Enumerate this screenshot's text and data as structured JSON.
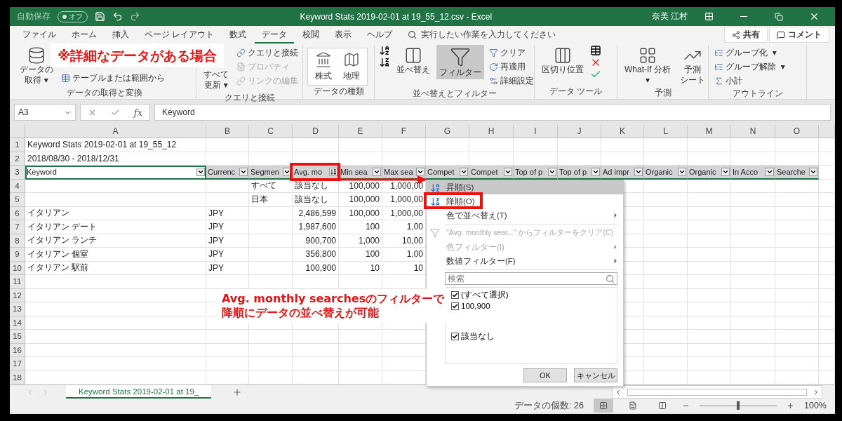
{
  "title_bar": {
    "autosave_label": "自動保存",
    "autosave_state": "オフ",
    "title": "Keyword Stats 2019-02-01 at 19_55_12.csv  -  Excel",
    "user": "奈美 江村"
  },
  "ribbon_tabs": [
    {
      "label": "ファイル",
      "selected": false
    },
    {
      "label": "ホーム",
      "selected": false
    },
    {
      "label": "挿入",
      "selected": false
    },
    {
      "label": "ページ レイアウト",
      "selected": false
    },
    {
      "label": "数式",
      "selected": false
    },
    {
      "label": "データ",
      "selected": true
    },
    {
      "label": "校閲",
      "selected": false
    },
    {
      "label": "表示",
      "selected": false
    },
    {
      "label": "ヘルプ",
      "selected": false
    }
  ],
  "tell_me": {
    "placeholder": "実行したい作業を入力してください"
  },
  "header_buttons": [
    "共有",
    "コメント"
  ],
  "ribbon_groups": [
    {
      "label": "データの取得と変換",
      "commands": [
        {
          "kind": "large",
          "lines": [
            "データの",
            "取得 ▾"
          ],
          "disabled": false,
          "pressed": false
        },
        {
          "kind": "small",
          "lines": [
            "テーブルまたは範囲から"
          ],
          "disabled": false,
          "pressed": false
        }
      ]
    },
    {
      "label": "クエリと接続",
      "commands": [
        {
          "kind": "large",
          "lines": [
            "すべて",
            "更新 ▾"
          ],
          "disabled": false,
          "pressed": false
        },
        {
          "kind": "small",
          "lines": [
            "クエリと接続"
          ],
          "disabled": false,
          "pressed": false
        },
        {
          "kind": "small",
          "lines": [
            "プロパティ"
          ],
          "disabled": true,
          "pressed": false
        },
        {
          "kind": "small",
          "lines": [
            "リンクの編集"
          ],
          "disabled": true,
          "pressed": false
        }
      ]
    },
    {
      "label": "データの種類",
      "commands": [
        {
          "kind": "gallery",
          "lines": [
            "株式"
          ],
          "disabled": false,
          "pressed": false
        },
        {
          "kind": "gallery",
          "lines": [
            "地理"
          ],
          "disabled": false,
          "pressed": false
        }
      ]
    },
    {
      "label": "並べ替えとフィルター",
      "commands": [
        {
          "kind": "large",
          "lines": [
            "並べ替え"
          ],
          "disabled": false,
          "pressed": false
        },
        {
          "kind": "large",
          "lines": [
            "フィルター"
          ],
          "disabled": false,
          "pressed": true
        },
        {
          "kind": "small",
          "lines": [
            "クリア"
          ],
          "disabled": false,
          "pressed": false
        },
        {
          "kind": "small",
          "lines": [
            "再適用"
          ],
          "disabled": false,
          "pressed": false
        },
        {
          "kind": "small",
          "lines": [
            "詳細設定"
          ],
          "disabled": false,
          "pressed": false
        }
      ]
    },
    {
      "label": "データ ツール",
      "commands": [
        {
          "kind": "large",
          "lines": [
            "区切り位置"
          ],
          "disabled": false,
          "pressed": false
        }
      ]
    },
    {
      "label": "予測",
      "commands": [
        {
          "kind": "large",
          "lines": [
            "What-If 分析",
            "▾"
          ],
          "disabled": false,
          "pressed": false
        },
        {
          "kind": "large",
          "lines": [
            "予測",
            "シート"
          ],
          "disabled": false,
          "pressed": false
        }
      ]
    },
    {
      "label": "アウトライン",
      "commands": [
        {
          "kind": "small",
          "lines": [
            "グループ化  ▾"
          ],
          "disabled": false,
          "pressed": false
        },
        {
          "kind": "small",
          "lines": [
            "グループ解除  ▾"
          ],
          "disabled": false,
          "pressed": false
        },
        {
          "kind": "small",
          "lines": [
            "小計"
          ],
          "disabled": false,
          "pressed": false
        }
      ]
    }
  ],
  "formula_bar": {
    "name_box": "A3",
    "fx_label": "fx",
    "formula": "Keyword"
  },
  "sheet": {
    "columns": [
      "A",
      "B",
      "C",
      "D",
      "E",
      "F",
      "G",
      "H",
      "I",
      "J",
      "K",
      "L",
      "M",
      "N",
      "O"
    ],
    "rows": [
      {
        "number": "1",
        "cells": [
          {
            "text": "Keyword Stats 2019-02-01 at 19_55_12",
            "kind": "text"
          },
          null,
          null,
          null,
          null,
          null,
          null,
          null,
          null,
          null,
          null,
          null,
          null,
          null,
          null
        ]
      },
      {
        "number": "2",
        "cells": [
          {
            "text": "2018/08/30 - 2018/12/31",
            "kind": "text"
          },
          null,
          null,
          null,
          null,
          null,
          null,
          null,
          null,
          null,
          null,
          null,
          null,
          null,
          null
        ]
      },
      {
        "number": "3",
        "cells": [
          {
            "text": "Keyword",
            "kind": "active-header"
          },
          {
            "text": "Currenc",
            "kind": "header"
          },
          {
            "text": "Segmen",
            "kind": "header"
          },
          {
            "text": "Avg. mo",
            "kind": "sorted-header"
          },
          {
            "text": "Min sea",
            "kind": "header"
          },
          {
            "text": "Max sea",
            "kind": "header"
          },
          {
            "text": "Compet",
            "kind": "header"
          },
          {
            "text": "Compet",
            "kind": "header"
          },
          {
            "text": "Top of p",
            "kind": "header"
          },
          {
            "text": "Top of p",
            "kind": "header"
          },
          {
            "text": "Ad impr",
            "kind": "header"
          },
          {
            "text": "Organic",
            "kind": "header"
          },
          {
            "text": "Organic",
            "kind": "header"
          },
          {
            "text": "In Acco",
            "kind": "header"
          },
          {
            "text": "Searche",
            "kind": "header"
          }
        ]
      },
      {
        "number": "4",
        "cells": [
          null,
          null,
          {
            "text": "すべて",
            "kind": "text"
          },
          {
            "text": "該当なし",
            "kind": "text"
          },
          {
            "text": "100,000",
            "kind": "number"
          },
          {
            "text": "1,000,00",
            "kind": "number"
          },
          null,
          null,
          null,
          null,
          null,
          null,
          null,
          null,
          null
        ]
      },
      {
        "number": "5",
        "cells": [
          null,
          null,
          {
            "text": "日本",
            "kind": "text"
          },
          {
            "text": "該当なし",
            "kind": "text"
          },
          {
            "text": "100,000",
            "kind": "number"
          },
          {
            "text": "1,000,00",
            "kind": "number"
          },
          null,
          null,
          null,
          null,
          null,
          null,
          null,
          null,
          null
        ]
      },
      {
        "number": "6",
        "cells": [
          {
            "text": "イタリアン",
            "kind": "text"
          },
          {
            "text": "JPY",
            "kind": "text"
          },
          null,
          {
            "text": "2,486,599",
            "kind": "number"
          },
          {
            "text": "100,000",
            "kind": "number"
          },
          {
            "text": "1,000,00",
            "kind": "number"
          },
          null,
          null,
          null,
          null,
          null,
          null,
          null,
          null,
          null
        ]
      },
      {
        "number": "7",
        "cells": [
          {
            "text": "イタリアン デート",
            "kind": "text"
          },
          {
            "text": "JPY",
            "kind": "text"
          },
          null,
          {
            "text": "1,987,600",
            "kind": "number"
          },
          {
            "text": "100",
            "kind": "number"
          },
          {
            "text": "1,00",
            "kind": "number"
          },
          null,
          null,
          null,
          null,
          null,
          null,
          null,
          null,
          null
        ]
      },
      {
        "number": "8",
        "cells": [
          {
            "text": "イタリアン ランチ",
            "kind": "text"
          },
          {
            "text": "JPY",
            "kind": "text"
          },
          null,
          {
            "text": "900,700",
            "kind": "number"
          },
          {
            "text": "1,000",
            "kind": "number"
          },
          {
            "text": "10,00",
            "kind": "number"
          },
          null,
          null,
          null,
          null,
          null,
          null,
          null,
          null,
          null
        ]
      },
      {
        "number": "9",
        "cells": [
          {
            "text": "イタリアン 個室",
            "kind": "text"
          },
          {
            "text": "JPY",
            "kind": "text"
          },
          null,
          {
            "text": "356,800",
            "kind": "number"
          },
          {
            "text": "100",
            "kind": "number"
          },
          {
            "text": "1,00",
            "kind": "number"
          },
          null,
          null,
          null,
          null,
          null,
          null,
          null,
          null,
          null
        ]
      },
      {
        "number": "10",
        "cells": [
          {
            "text": "イタリアン 駅前",
            "kind": "text"
          },
          {
            "text": "JPY",
            "kind": "text"
          },
          null,
          {
            "text": "100,900",
            "kind": "number"
          },
          {
            "text": "10",
            "kind": "number"
          },
          {
            "text": "10",
            "kind": "number"
          },
          null,
          null,
          null,
          null,
          null,
          null,
          null,
          null,
          null
        ]
      },
      {
        "number": "11",
        "cells": []
      },
      {
        "number": "12",
        "cells": []
      },
      {
        "number": "13",
        "cells": []
      },
      {
        "number": "14",
        "cells": []
      },
      {
        "number": "15",
        "cells": []
      },
      {
        "number": "16",
        "cells": []
      },
      {
        "number": "17",
        "cells": []
      },
      {
        "number": "18",
        "cells": []
      }
    ]
  },
  "filter_menu": {
    "items": [
      {
        "kind": "sort-ascending",
        "label": "昇順(S)",
        "hovered": true,
        "disabled": false,
        "submenu": false
      },
      {
        "kind": "sort-descending",
        "label": "降順(O)",
        "hovered": false,
        "disabled": false,
        "submenu": false
      },
      {
        "kind": "command",
        "label": "色で並べ替え(T)",
        "hovered": false,
        "disabled": false,
        "submenu": true
      },
      {
        "kind": "clear",
        "label": "\"Avg. monthly sear...\" からフィルターをクリア(C)",
        "hovered": false,
        "disabled": true,
        "submenu": false
      },
      {
        "kind": "command",
        "label": "色フィルター(I)",
        "hovered": false,
        "disabled": true,
        "submenu": true
      },
      {
        "kind": "command",
        "label": "数値フィルター(F)",
        "hovered": false,
        "disabled": false,
        "submenu": true
      }
    ],
    "search": {
      "placeholder": "検索"
    },
    "values": [
      {
        "label": "(すべて選択)",
        "checked": true
      },
      {
        "label": "100,900",
        "checked": true
      },
      {
        "label": "該当なし",
        "checked": true
      }
    ],
    "buttons": [
      "OK",
      "キャンセル"
    ]
  },
  "sheet_tabs": [
    {
      "label": "Keyword Stats 2019-02-01 at 19_",
      "selected": true
    }
  ],
  "status_bar": {
    "count": "データの個数: 26",
    "views": [
      {
        "kind": "normal",
        "selected": true
      },
      {
        "kind": "page-layout",
        "selected": false
      },
      {
        "kind": "page-break",
        "selected": false
      }
    ],
    "zoom": {
      "level": 0.5,
      "reading": "100%"
    }
  },
  "annotations": [
    {
      "kind": "label",
      "lines": [
        "※詳細なデータがある場合"
      ]
    },
    {
      "kind": "label",
      "lines": [
        "Avg. monthly searchesのフィルターで",
        "降順にデータの並べ替えが可能"
      ]
    }
  ]
}
